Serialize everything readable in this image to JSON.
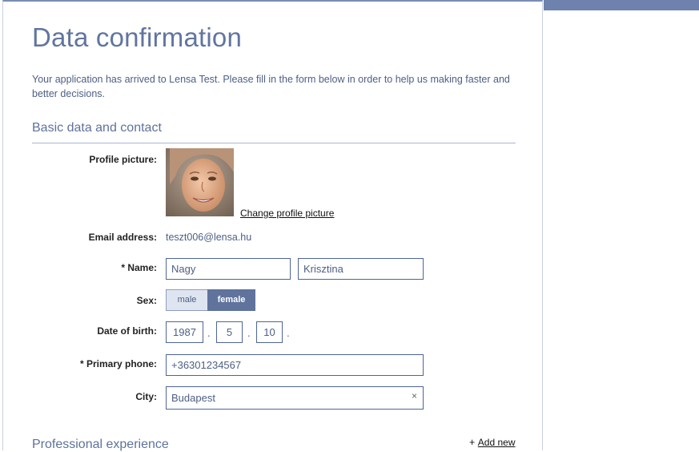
{
  "page": {
    "title": "Data confirmation",
    "intro": "Your application has arrived to Lensa Test. Please fill in the form below in order to help us making faster and better decisions."
  },
  "basic": {
    "heading": "Basic data and contact",
    "profile_picture_label": "Profile picture:",
    "change_picture_link": "Change profile picture",
    "email_label": "Email address:",
    "email_value": "teszt006@lensa.hu",
    "name_label": "* Name:",
    "last_name": "Nagy",
    "first_name": "Krisztina",
    "sex_label": "Sex:",
    "sex_options": [
      "male",
      "female"
    ],
    "sex_selected": "female",
    "dob_label": "Date of birth:",
    "dob_year": "1987",
    "dob_month": "5",
    "dob_day": "10",
    "dob_sep": ".",
    "phone_label": "* Primary phone:",
    "phone_value": "+36301234567",
    "city_label": "City:",
    "city_value": "Budapest",
    "clear_symbol": "×"
  },
  "professional": {
    "heading": "Professional experience",
    "add_prefix": "+",
    "add_label": "Add new"
  },
  "colors": {
    "accent": "#61759f",
    "selected_segment": "#5f739d",
    "topbar": "#6f82ad"
  }
}
